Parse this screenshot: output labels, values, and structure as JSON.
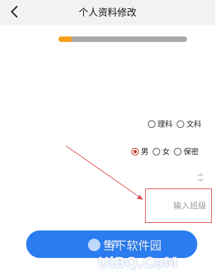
{
  "header": {
    "title": "个人资料修改"
  },
  "progress": {
    "value": 0.1,
    "fill_color": "#f5a018",
    "track_color": "#a9a9a9"
  },
  "subject": {
    "options": [
      "理科",
      "文科"
    ],
    "selected": null
  },
  "gender": {
    "options": [
      "男",
      "女",
      "保密"
    ],
    "selected": "男"
  },
  "class_input": {
    "placeholder": "输入班级",
    "value": ""
  },
  "save_button": {
    "label": "保存"
  },
  "watermark": {
    "line1": "当下软件园",
    "line2": "UiBQ.CoM"
  },
  "colors": {
    "accent": "#2b7cf0",
    "annotation": "#d94a4a"
  },
  "icons": {
    "back": "chevron-left-icon",
    "stepper": "stepper-icon",
    "annotation": "arrow-annotation-icon"
  }
}
